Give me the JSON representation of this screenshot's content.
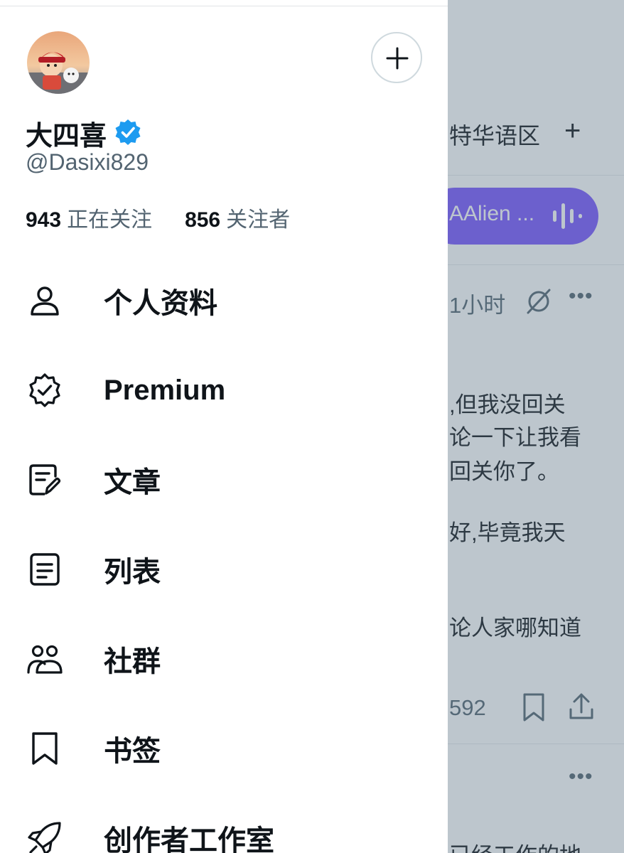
{
  "drawer": {
    "display_name": "大四喜",
    "handle": "@Dasixi829",
    "following_count": "943",
    "following_label": "正在关注",
    "followers_count": "856",
    "followers_label": "关注者",
    "menu": [
      {
        "label": "个人资料",
        "icon": "profile-icon"
      },
      {
        "label": "Premium",
        "icon": "premium-icon"
      },
      {
        "label": "文章",
        "icon": "articles-icon"
      },
      {
        "label": "列表",
        "icon": "lists-icon"
      },
      {
        "label": "社群",
        "icon": "communities-icon"
      },
      {
        "label": "书签",
        "icon": "bookmark-icon"
      },
      {
        "label": "创作者工作室",
        "icon": "rocket-icon"
      }
    ]
  },
  "timeline": {
    "tab_label": "特华语区",
    "space_label": "AAlien ...",
    "post_time": "1小时",
    "post_lines": [
      ",但我没回关",
      "论一下让我看",
      "回关你了。",
      "好,毕竟我天",
      "论人家哪知道",
      "已经工作的地"
    ],
    "view_count": "592"
  },
  "colors": {
    "verified_blue": "#1d9bf0",
    "space_purple": "#7856ff",
    "secondary_text": "#536471",
    "primary_text": "#0f1419"
  }
}
